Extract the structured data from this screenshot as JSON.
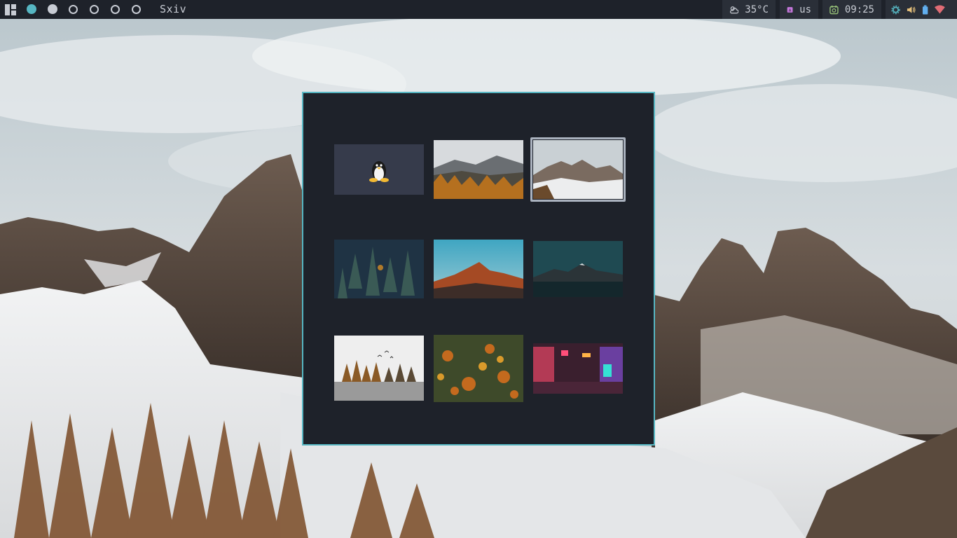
{
  "topbar": {
    "workspaces": [
      {
        "state": "active",
        "icon": "workspace-active-dot-icon"
      },
      {
        "state": "occupied",
        "icon": "workspace-occupied-dot-icon"
      },
      {
        "state": "empty",
        "icon": "workspace-empty-circle-icon"
      },
      {
        "state": "empty",
        "icon": "workspace-empty-circle-icon"
      },
      {
        "state": "empty",
        "icon": "workspace-empty-circle-icon"
      },
      {
        "state": "empty",
        "icon": "workspace-empty-circle-icon"
      }
    ],
    "window_title": "Sxiv",
    "weather": {
      "icon": "cloud-sun-icon",
      "text": "35°C"
    },
    "keyboard": {
      "icon": "keyboard-layout-icon",
      "text": "us"
    },
    "clock": {
      "icon": "clock-icon",
      "text": "09:25"
    },
    "tray_icons": [
      "settings-gear-icon",
      "volume-icon",
      "battery-icon",
      "wifi-icon"
    ]
  },
  "colors": {
    "bar_bg": "#1e222a",
    "module_bg": "#2a2f38",
    "accent": "#56b6c2",
    "text": "#c8ccd4",
    "keyboard_icon": "#c678dd",
    "clock_icon": "#98c379",
    "settings_icon": "#56b6c2",
    "volume_icon": "#e5c07b",
    "battery_icon": "#61afef",
    "wifi_icon": "#e06c75"
  },
  "sxiv": {
    "thumbnails": [
      {
        "name": "tux-logo",
        "selected": false
      },
      {
        "name": "autumn-mountain-valley",
        "selected": false
      },
      {
        "name": "snowy-rocky-peaks",
        "selected": true
      },
      {
        "name": "pine-forest-aerial",
        "selected": false
      },
      {
        "name": "sunset-mountain-ridge",
        "selected": false
      },
      {
        "name": "teal-mountain-lake",
        "selected": false
      },
      {
        "name": "misty-treeline-birds",
        "selected": false
      },
      {
        "name": "autumn-forest-aerial",
        "selected": false
      },
      {
        "name": "neon-city-street",
        "selected": false
      }
    ]
  }
}
